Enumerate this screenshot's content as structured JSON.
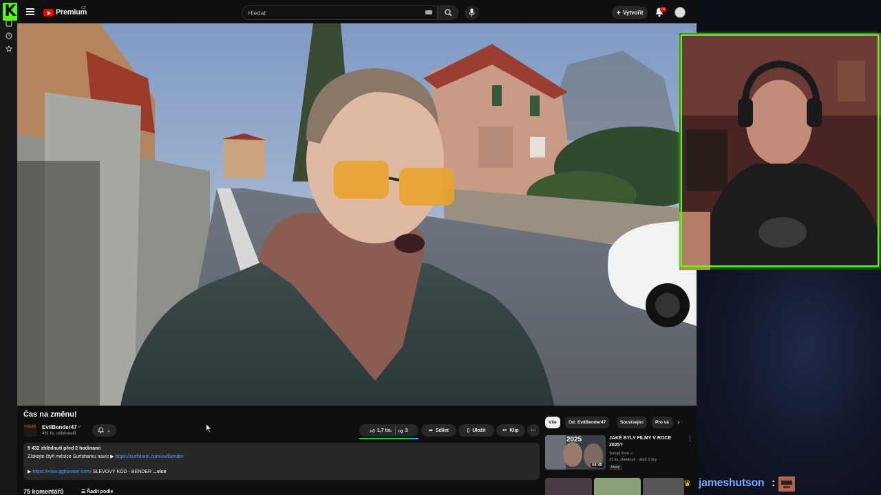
{
  "kick": {
    "logo": "K"
  },
  "header": {
    "logo_text": "Premium",
    "region": "CZ",
    "search_placeholder": "Hledat",
    "create_label": "Vytvořit",
    "notification_count": "9+"
  },
  "video": {
    "title": "Čas na změnu!",
    "channel": {
      "avatar_text": "FREAK",
      "name": "EvilBender47",
      "subscribers": "491 tis. odběratelů"
    },
    "likes": "1,7 tis.",
    "dislikes": "3",
    "like_ratio": 0.85,
    "share_label": "Sdílet",
    "save_label": "Uložit",
    "clip_label": "Klip",
    "description": {
      "stats": "9 432 zhlédnutí  před 2 hodinami",
      "line1_text": "Získejte čtyři měsíce Surfsharku navíc ▶ ",
      "line1_link": "https://surfshark.com/evilbender",
      "line2_prefix": "▶ ",
      "line2_link": "https://www.ggbooster.com/",
      "line2_text": " SLEVOVÝ KÓD - BENDER",
      "more": "...více"
    },
    "comments_count": "75 komentářů",
    "sort_label": "Řadit podle"
  },
  "sidebar": {
    "chips": [
      "Vše",
      "Od: EvilBender47",
      "Související",
      "Pro vá"
    ],
    "recommendation": {
      "thumb_text": "2025",
      "duration": "44:49",
      "title": "JAKÉ BYLY FILMY V ROCE 2025?",
      "channel": "Tomáš Krch",
      "meta": "21 tis. zhlédnutí · před 3 dny",
      "badge": "Nový"
    }
  },
  "chat": {
    "username": "jameshutson",
    "separator": ":"
  },
  "colors": {
    "kick_green": "#53fc18",
    "yt_red": "#ff0000",
    "link_blue": "#3ea6ff",
    "chat_user": "#7aa7ff"
  }
}
